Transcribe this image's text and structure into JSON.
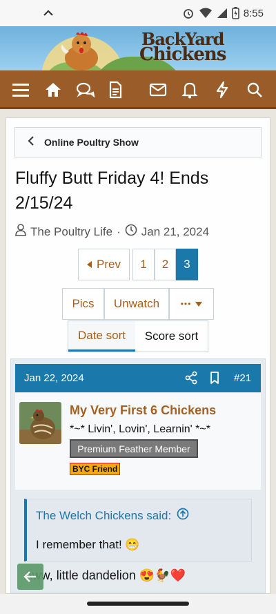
{
  "status_bar": {
    "time": "8:55"
  },
  "logo": {
    "line1": "BackYard",
    "line2": "Chickens"
  },
  "breadcrumb": {
    "label": "Online Poultry Show"
  },
  "thread": {
    "title": "Fluffy Butt Friday 4! Ends 2/15/24",
    "author": "The Poultry Life",
    "separator": "·",
    "date": "Jan 21, 2024"
  },
  "pagination": {
    "prev_label": "Prev",
    "pages": [
      "1",
      "2",
      "3"
    ],
    "current_page": "3"
  },
  "actions": {
    "pics_label": "Pics",
    "unwatch_label": "Unwatch",
    "more_label": "•••"
  },
  "sort": {
    "date_label": "Date sort",
    "score_label": "Score sort",
    "selected": "Date sort"
  },
  "post": {
    "date": "Jan 22, 2024",
    "number": "#21",
    "username": "My Very First 6 Chickens",
    "user_title": "*~* Livin', Lovin', Learnin' *~*",
    "badge_primary": "Premium Feather Member",
    "badge_secondary": "BYC Friend",
    "quote_author": "The Welch Chickens said:",
    "quote_text": "I remember that! 😁",
    "body": "Aww, little dandelion 😍🐓❤️"
  },
  "colors": {
    "nav_brown": "#9a5c29",
    "accent_blue": "#1b78aa",
    "link_brown": "#a55f1e",
    "badge_grey": "#7a7a7a",
    "badge_orange": "#f5a814"
  },
  "icons": {
    "navbar": [
      "menu-icon",
      "home-icon",
      "chat-icon",
      "document-icon",
      "mail-icon",
      "bell-icon",
      "bolt-icon",
      "search-icon"
    ],
    "post_header": [
      "share-icon",
      "bookmark-icon"
    ]
  }
}
